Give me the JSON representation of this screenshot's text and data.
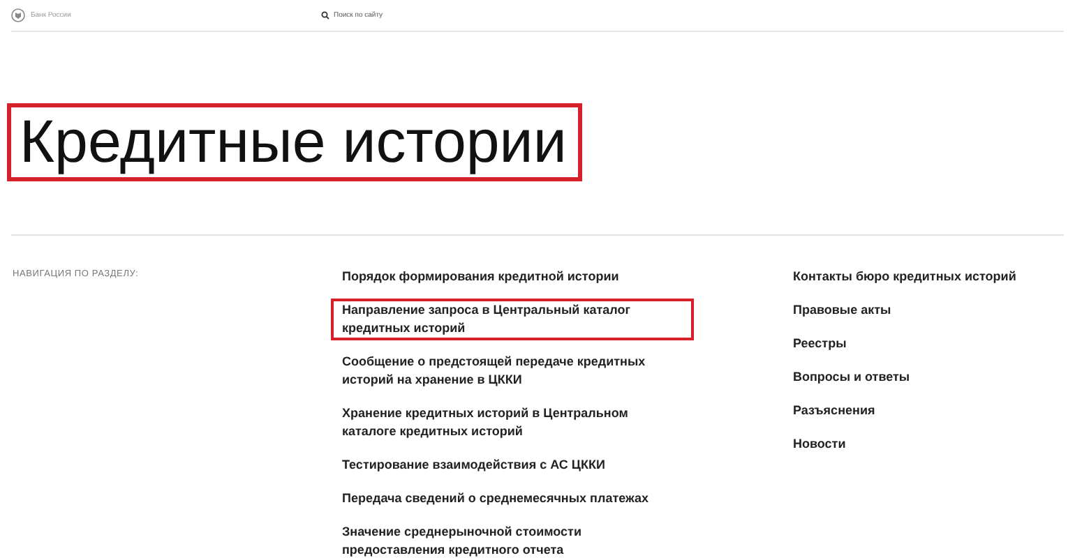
{
  "header": {
    "logo_text": "Банк России",
    "search": {
      "placeholder": "Поиск по сайту"
    }
  },
  "title": {
    "text": "Кредитные истории",
    "highlighted": true
  },
  "navigation": {
    "label": "НАВИГАЦИЯ ПО РАЗДЕЛУ:",
    "main_links": [
      {
        "text": "Порядок формирования кредитной истории",
        "highlighted": false
      },
      {
        "text": "Направление запроса в Центральный каталог кредитных историй",
        "highlighted": true
      },
      {
        "text": "Сообщение о предстоящей передаче кредитных историй на хранение в ЦККИ",
        "highlighted": false
      },
      {
        "text": "Хранение кредитных историй в Центральном каталоге кредитных историй",
        "highlighted": false
      },
      {
        "text": "Тестирование взаимодействия с АС ЦККИ",
        "highlighted": false
      },
      {
        "text": "Передача сведений о среднемесячных платежах",
        "highlighted": false
      },
      {
        "text": "Значение среднерыночной стоимости предоставления кредитного отчета",
        "highlighted": false
      }
    ],
    "side_links": [
      "Контакты бюро кредитных историй",
      "Правовые акты",
      "Реестры",
      "Вопросы и ответы",
      "Разъяснения",
      "Новости"
    ]
  }
}
